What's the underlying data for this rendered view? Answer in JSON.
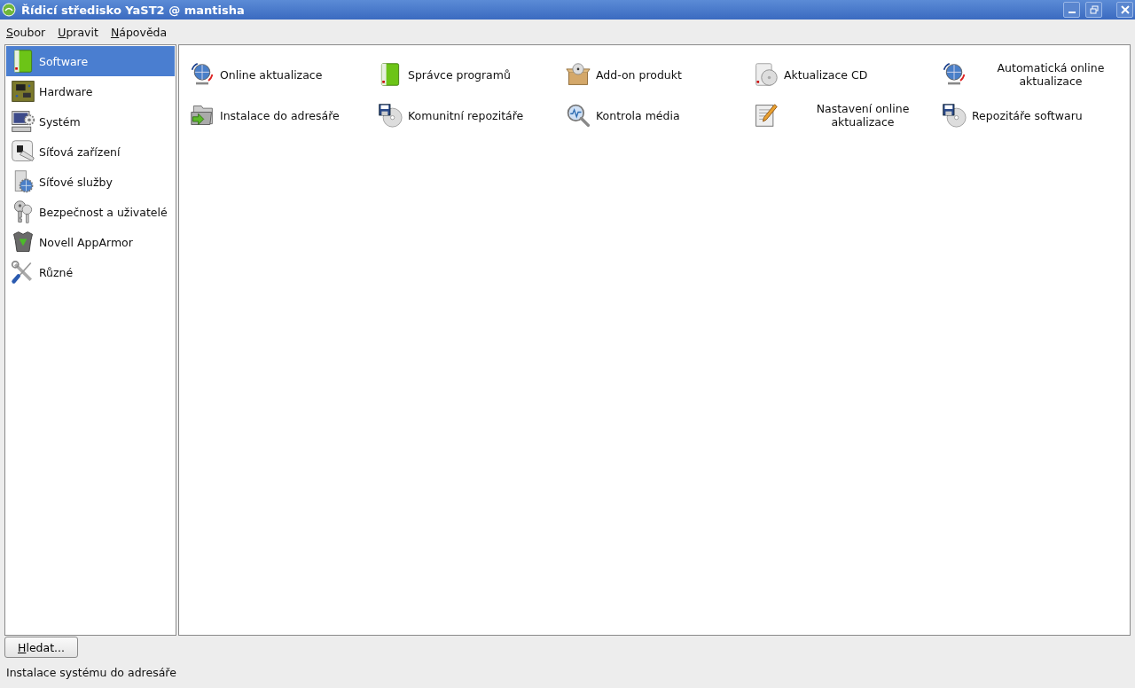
{
  "window": {
    "title": "Řídicí středisko YaST2 @ mantisha"
  },
  "menu": [
    "Soubor",
    "Upravit",
    "Nápověda"
  ],
  "sidebar": {
    "items": [
      {
        "label": "Software",
        "selected": true
      },
      {
        "label": "Hardware",
        "selected": false
      },
      {
        "label": "Systém",
        "selected": false
      },
      {
        "label": "Síťová zařízení",
        "selected": false
      },
      {
        "label": "Síťové služby",
        "selected": false
      },
      {
        "label": "Bezpečnost a uživatelé",
        "selected": false
      },
      {
        "label": "Novell AppArmor",
        "selected": false
      },
      {
        "label": "Různé",
        "selected": false
      }
    ]
  },
  "modules": [
    {
      "label": "Online aktualizace"
    },
    {
      "label": "Správce programů"
    },
    {
      "label": "Add-on produkt"
    },
    {
      "label": "Aktualizace CD"
    },
    {
      "label": "Automatická online aktualizace"
    },
    {
      "label": "Instalace do adresáře"
    },
    {
      "label": "Komunitní repozitáře"
    },
    {
      "label": "Kontrola média"
    },
    {
      "label": "Nastavení online aktualizace"
    },
    {
      "label": "Repozitáře softwaru"
    }
  ],
  "search_button": "Hledat...",
  "status_bar": "Instalace systému do adresáře"
}
